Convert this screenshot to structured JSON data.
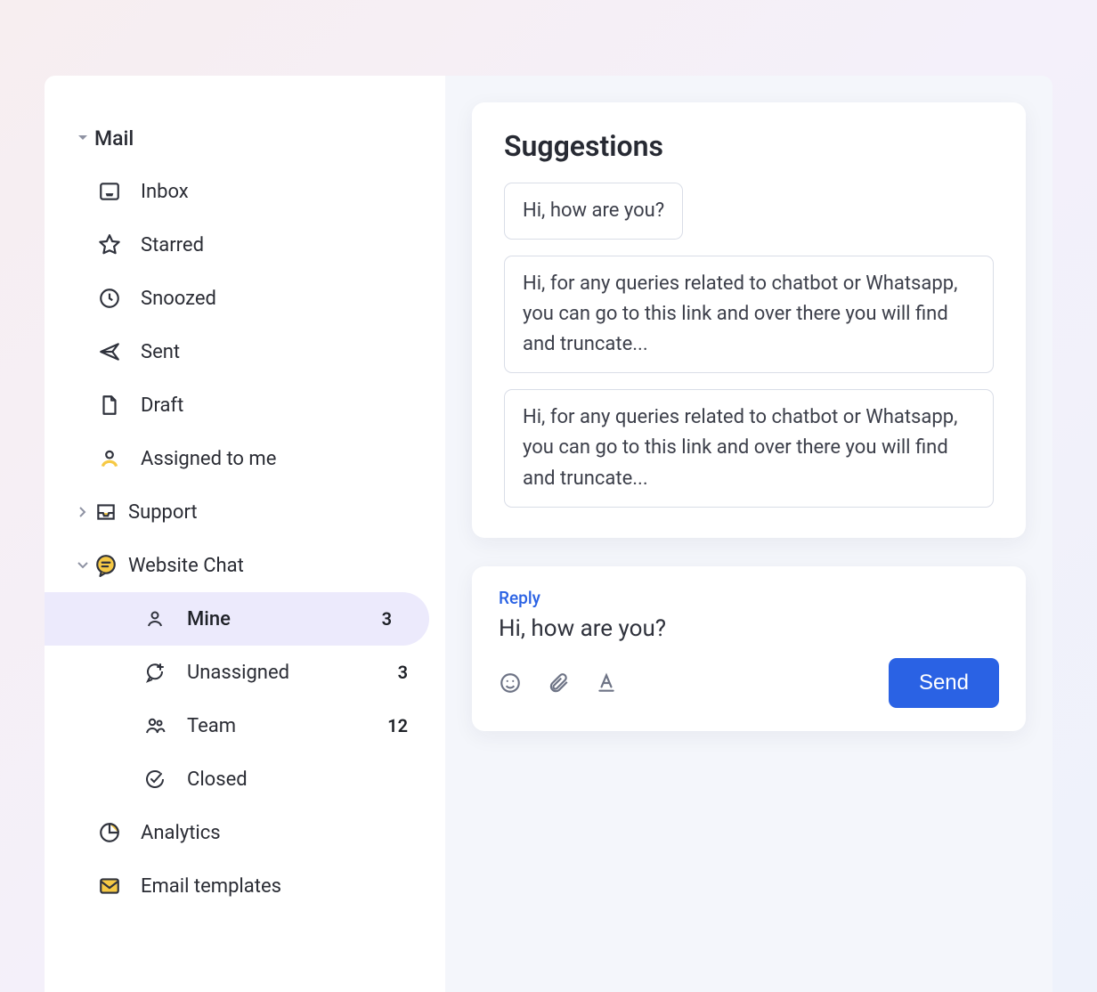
{
  "sidebar": {
    "mail_label": "Mail",
    "items": {
      "inbox": {
        "label": "Inbox"
      },
      "starred": {
        "label": "Starred"
      },
      "snoozed": {
        "label": "Snoozed"
      },
      "sent": {
        "label": "Sent"
      },
      "draft": {
        "label": "Draft"
      },
      "assigned": {
        "label": "Assigned to me"
      },
      "support": {
        "label": "Support"
      },
      "website_chat": {
        "label": "Website Chat"
      },
      "mine": {
        "label": "Mine",
        "count": "3"
      },
      "unassigned": {
        "label": "Unassigned",
        "count": "3"
      },
      "team": {
        "label": "Team",
        "count": "12"
      },
      "closed": {
        "label": "Closed"
      },
      "analytics": {
        "label": "Analytics"
      },
      "templates": {
        "label": "Email templates"
      }
    }
  },
  "suggestions": {
    "title": "Suggestions",
    "items": [
      "Hi, how are you?",
      "Hi, for any queries related to chatbot or Whatsapp, you can go to this link and over there you will find and truncate...",
      "Hi, for any queries related to chatbot or Whatsapp, you can go to this link and over there you will find and truncate..."
    ]
  },
  "reply": {
    "label": "Reply",
    "text": "Hi, how are you?",
    "send": "Send"
  },
  "colors": {
    "accent": "#2a62e4",
    "highlight_bg": "#eceafc",
    "icon_yellow": "#f6c945"
  }
}
